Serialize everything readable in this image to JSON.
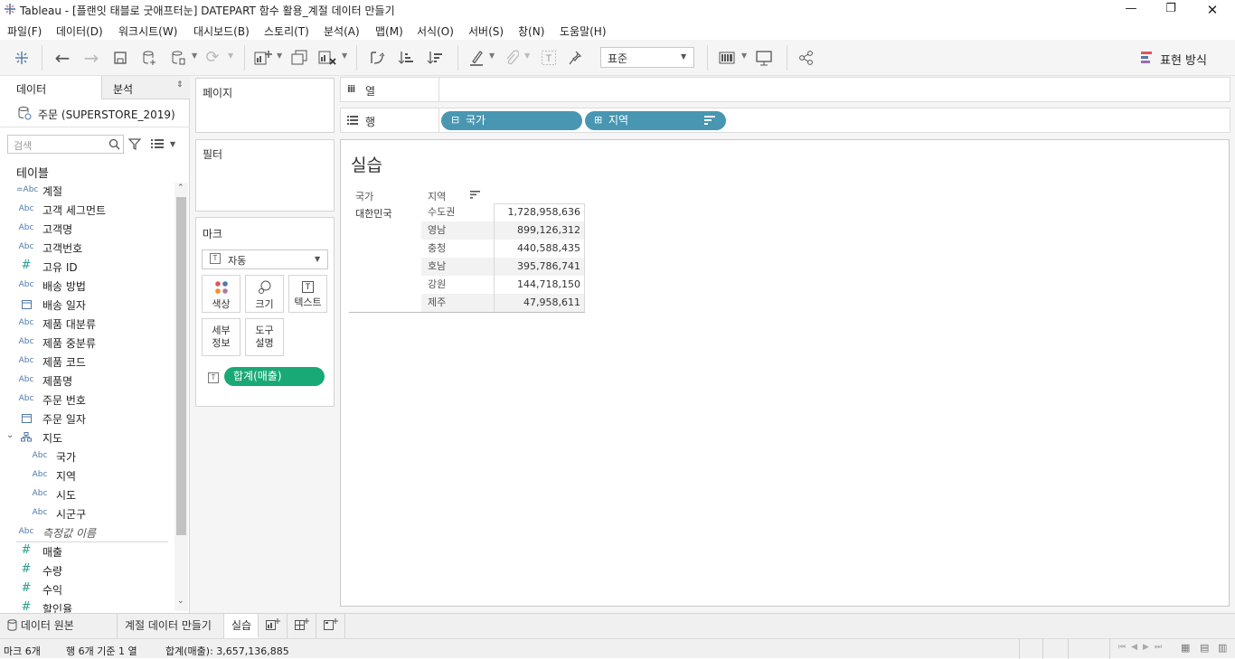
{
  "window": {
    "title": "Tableau - [플랜잇 태블로 굿애프터눈] DATEPART 함수 활용_계절 데이터 만들기",
    "controls": [
      "minimize",
      "restore",
      "close"
    ]
  },
  "menu": [
    "파일(F)",
    "데이터(D)",
    "워크시트(W)",
    "대시보드(B)",
    "스토리(T)",
    "분석(A)",
    "맵(M)",
    "서식(O)",
    "서버(S)",
    "창(N)",
    "도움말(H)"
  ],
  "toolbar": {
    "fit_select": "표준",
    "show_me": "표현 방식"
  },
  "left_panel": {
    "tab_data": "데이터",
    "tab_analysis": "분석",
    "datasource": "주문 (SUPERSTORE_2019)",
    "search_placeholder": "검색",
    "tables_header": "테이블",
    "fields": [
      {
        "type": "=Abc",
        "name": "계절",
        "indent": 0,
        "italic": false
      },
      {
        "type": "Abc",
        "name": "고객 세그먼트",
        "indent": 0,
        "italic": false
      },
      {
        "type": "Abc",
        "name": "고객명",
        "indent": 0,
        "italic": false
      },
      {
        "type": "Abc",
        "name": "고객번호",
        "indent": 0,
        "italic": false
      },
      {
        "type": "#",
        "name": "고유 ID",
        "indent": 0,
        "italic": false
      },
      {
        "type": "Abc",
        "name": "배송 방법",
        "indent": 0,
        "italic": false
      },
      {
        "type": "date",
        "name": "배송 일자",
        "indent": 0,
        "italic": false
      },
      {
        "type": "Abc",
        "name": "제품 대분류",
        "indent": 0,
        "italic": false
      },
      {
        "type": "Abc",
        "name": "제품 중분류",
        "indent": 0,
        "italic": false
      },
      {
        "type": "Abc",
        "name": "제품 코드",
        "indent": 0,
        "italic": false
      },
      {
        "type": "Abc",
        "name": "제품명",
        "indent": 0,
        "italic": false
      },
      {
        "type": "Abc",
        "name": "주문 번호",
        "indent": 0,
        "italic": false
      },
      {
        "type": "date",
        "name": "주문 일자",
        "indent": 0,
        "italic": false
      },
      {
        "type": "hier",
        "name": "지도",
        "indent": 0,
        "italic": false
      },
      {
        "type": "Abc",
        "name": "국가",
        "indent": 1,
        "italic": false
      },
      {
        "type": "Abc",
        "name": "지역",
        "indent": 1,
        "italic": false
      },
      {
        "type": "Abc",
        "name": "시도",
        "indent": 1,
        "italic": false
      },
      {
        "type": "Abc",
        "name": "시군구",
        "indent": 1,
        "italic": false
      },
      {
        "type": "Abc",
        "name": "측정값 이름",
        "indent": 0,
        "italic": true
      },
      {
        "type": "#",
        "name": "매출",
        "indent": 0,
        "italic": false
      },
      {
        "type": "#",
        "name": "수량",
        "indent": 0,
        "italic": false
      },
      {
        "type": "#",
        "name": "수익",
        "indent": 0,
        "italic": false
      },
      {
        "type": "#",
        "name": "할인율",
        "indent": 0,
        "italic": false
      }
    ]
  },
  "cards": {
    "pages": "페이지",
    "filters": "필터",
    "marks": "마크",
    "mark_type": "자동",
    "mark_buttons": [
      "색상",
      "크기",
      "텍스트",
      "세부 정보",
      "도구 설명"
    ],
    "mark_buttons_lines": [
      [
        "색상"
      ],
      [
        "크기"
      ],
      [
        "텍스트"
      ],
      [
        "세부",
        "정보"
      ],
      [
        "도구",
        "설명"
      ]
    ],
    "text_pill": "합계(매출)"
  },
  "shelves": {
    "columns_label": "열",
    "rows_label": "행",
    "row_pills": [
      "국가",
      "지역"
    ]
  },
  "view": {
    "title": "실습",
    "header_country": "국가",
    "header_region": "지역",
    "country": "대한민국",
    "rows": [
      {
        "region": "수도권",
        "value": "1,728,958,636"
      },
      {
        "region": "영남",
        "value": "899,126,312"
      },
      {
        "region": "충청",
        "value": "440,588,435"
      },
      {
        "region": "호남",
        "value": "395,786,741"
      },
      {
        "region": "강원",
        "value": "144,718,150"
      },
      {
        "region": "제주",
        "value": "47,958,611"
      }
    ]
  },
  "tabs": {
    "datasource": "데이터 원본",
    "sheets": [
      "계절 데이터 만들기",
      "실습"
    ],
    "active_sheet": "실습"
  },
  "status": {
    "marks": "마크 6개",
    "rows_cols": "행 6개 기준 1 열",
    "sum": "합계(매출): 3,657,136,885"
  }
}
